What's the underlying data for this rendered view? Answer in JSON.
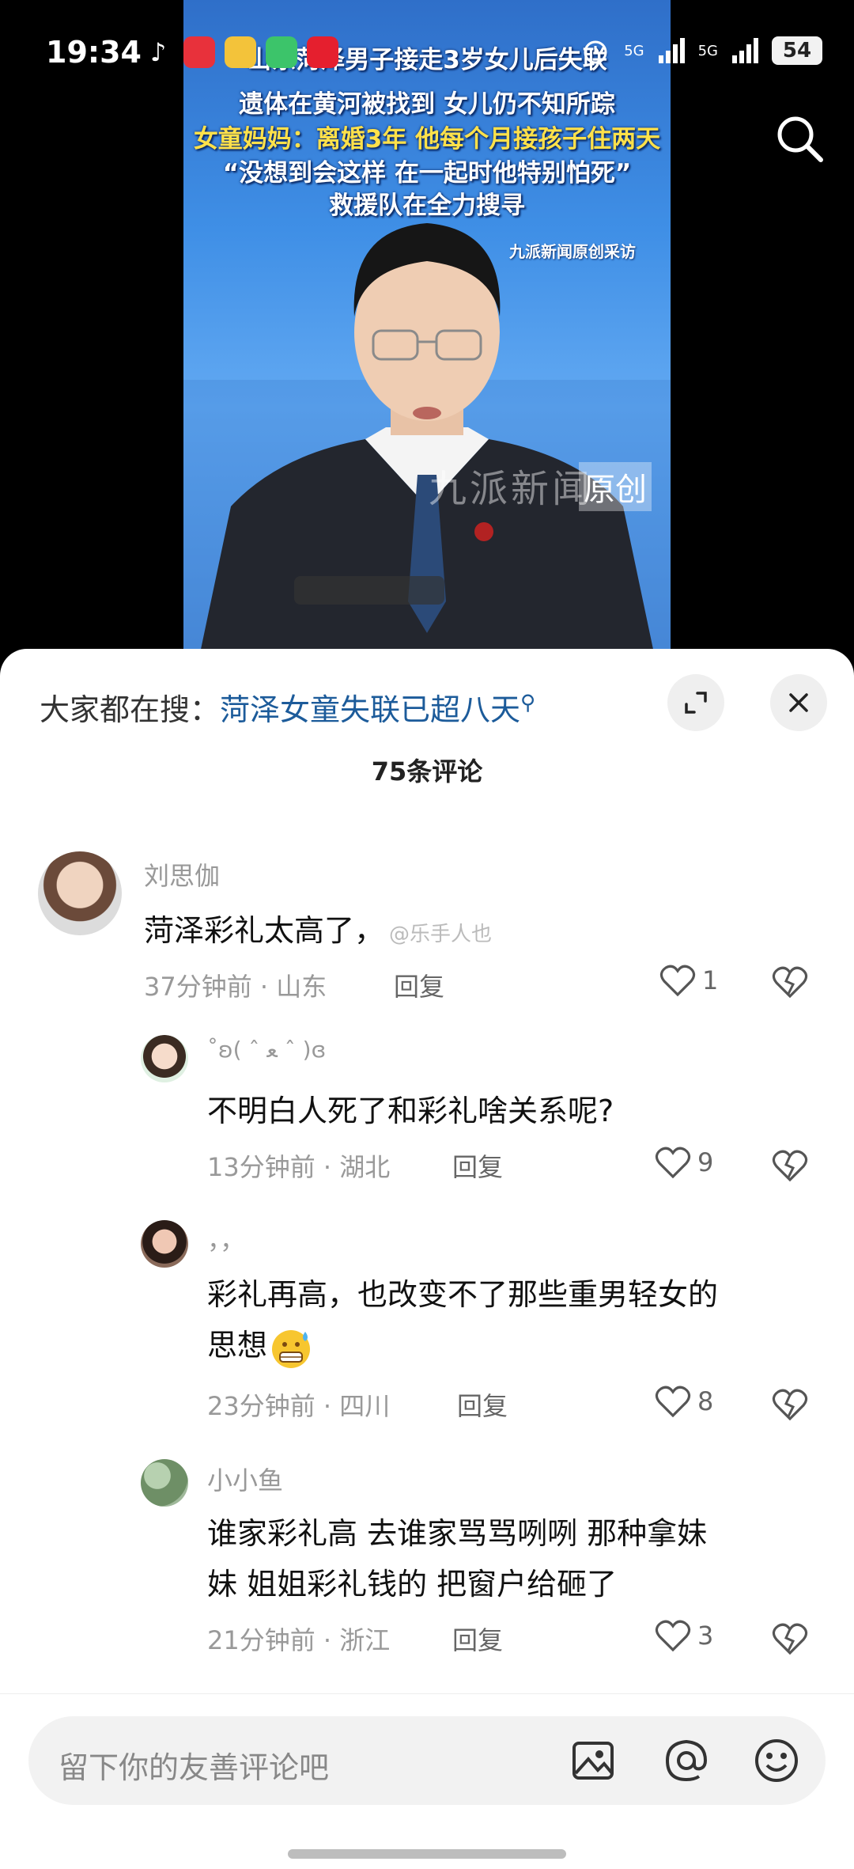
{
  "status_bar": {
    "time": "19:34",
    "network_1": "5G",
    "network_2": "5G",
    "battery": "54"
  },
  "video": {
    "headlines": [
      "山东菏泽男子接走3岁女儿后失联",
      "遗体在黄河被找到  女儿仍不知所踪",
      "女童妈妈：离婚3年 他每个月接孩子住两天",
      "“没想到会这样  在一起时他特别怕死”",
      "救援队在全力搜寻"
    ],
    "source": "九派新闻原创采访",
    "watermark": "九派新闻",
    "watermark_tag": "原创"
  },
  "sheet": {
    "suggest_prefix": "大家都在搜：",
    "suggest_link": "菏泽女童失联已超八天",
    "comment_count": "75条评论"
  },
  "comments": [
    {
      "username": "刘思伽",
      "text": "菏泽彩礼太高了，",
      "inline_watermark": "@乐手人也",
      "time": "37分钟前",
      "location": "山东",
      "reply_label": "回复",
      "likes": "1"
    },
    {
      "username": "˚ʚ(   ˆ ﻌ ˆ )ɞ",
      "text": "不明白人死了和彩礼啥关系呢?",
      "time": "13分钟前",
      "location": "湖北",
      "reply_label": "回复",
      "likes": "9"
    },
    {
      "username": "，，",
      "text_line1": "彩礼再高，也改变不了那些重男轻女的",
      "text_line2": "思想",
      "time": "23分钟前",
      "location": "四川",
      "reply_label": "回复",
      "likes": "8"
    },
    {
      "username": "小小鱼",
      "text_line1": "谁家彩礼高 去谁家骂骂咧咧  那种拿妹",
      "text_line2": "妹 姐姐彩礼钱的 把窗户给砸了",
      "time": "21分钟前",
      "location": "浙江",
      "reply_label": "回复",
      "likes": "3"
    }
  ],
  "input": {
    "placeholder": "留下你的友善评论吧"
  },
  "colors": {
    "link": "#1c5b9a",
    "muted": "#999999",
    "video_bg": "#3f8fe6"
  }
}
